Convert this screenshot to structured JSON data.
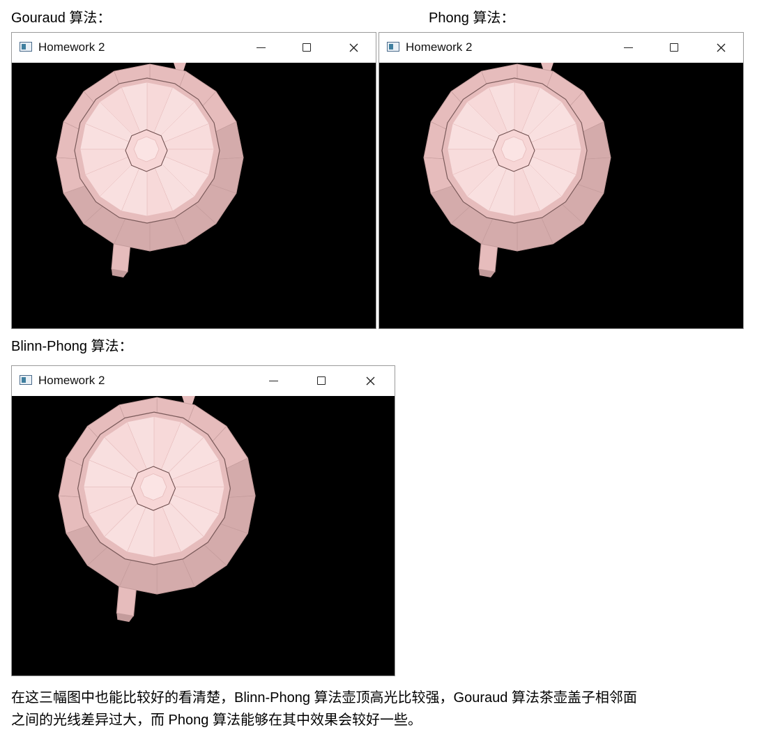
{
  "captions": {
    "gouraud": "Gouraud 算法：",
    "phong": "Phong 算法：",
    "blinn": "Blinn-Phong 算法："
  },
  "windows": [
    {
      "title": "Homework 2",
      "minimize": "—",
      "maximize": "☐",
      "close": "✕"
    },
    {
      "title": "Homework 2",
      "minimize": "—",
      "maximize": "☐",
      "close": "✕"
    },
    {
      "title": "Homework 2",
      "minimize": "—",
      "maximize": "☐",
      "close": "✕"
    }
  ],
  "paragraph": {
    "line1": "在这三幅图中也能比较好的看清楚，Blinn-Phong 算法壶顶高光比较强，Gouraud 算法茶壶盖子相邻面",
    "line2": "之间的光线差异过大，而 Phong 算法能够在其中效果会较好一些。"
  },
  "colors": {
    "teapot_light": "#f7d6d6",
    "teapot_mid": "#e6bcbc",
    "teapot_dark": "#c49c9c",
    "viewport_bg": "#000000"
  },
  "icons": {
    "app": "app-window-icon",
    "minimize": "minimize-icon",
    "maximize": "maximize-icon",
    "close": "close-icon"
  }
}
